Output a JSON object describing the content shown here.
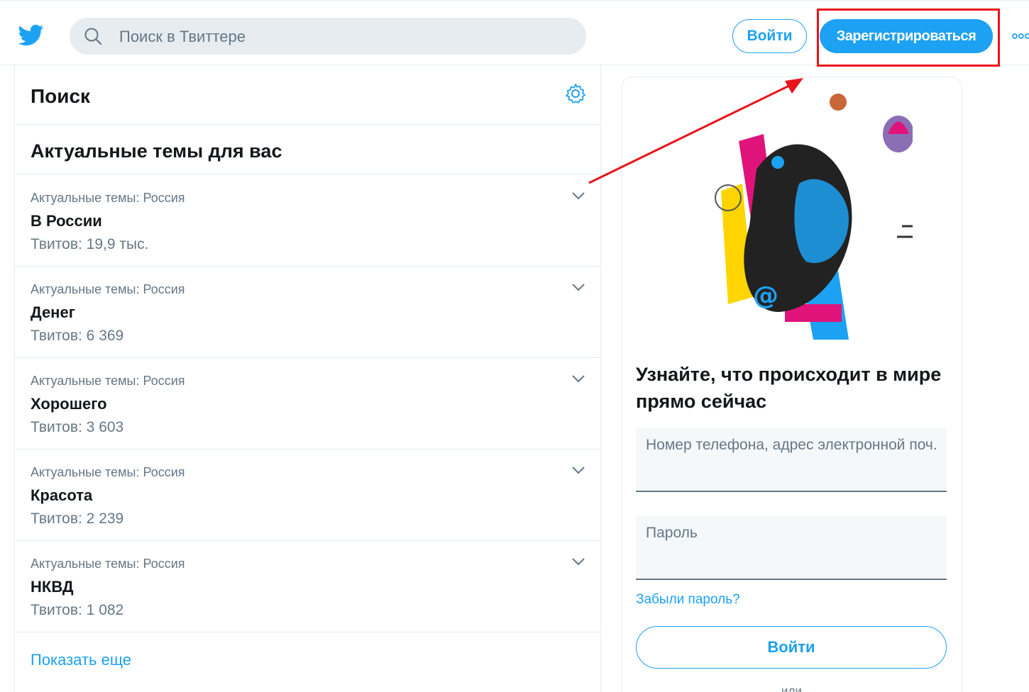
{
  "header": {
    "search_placeholder": "Поиск в Твиттере",
    "login_label": "Войти",
    "signup_label": "Зарегистрироваться"
  },
  "left": {
    "title": "Поиск",
    "trends_title": "Актуальные темы для вас",
    "trends": [
      {
        "context": "Актуальные темы: Россия",
        "name": "В России",
        "count": "Твитов: 19,9 тыс."
      },
      {
        "context": "Актуальные темы: Россия",
        "name": "Денег",
        "count": "Твитов: 6 369"
      },
      {
        "context": "Актуальные темы: Россия",
        "name": "Хорошего",
        "count": "Твитов: 3 603"
      },
      {
        "context": "Актуальные темы: Россия",
        "name": "Красота",
        "count": "Твитов: 2 239"
      },
      {
        "context": "Актуальные темы: Россия",
        "name": "НКВД",
        "count": "Твитов: 1 082"
      }
    ],
    "show_more": "Показать еще"
  },
  "card": {
    "title": "Узнайте, что происходит в мире прямо сейчас",
    "phone_placeholder": "Номер телефона, адрес электронной поч...",
    "password_placeholder": "Пароль",
    "forgot_label": "Забыли пароль?",
    "login_label": "Войти",
    "or_label": "или"
  },
  "colors": {
    "brand": "#1da1f2",
    "annotation": "#e8141b"
  }
}
